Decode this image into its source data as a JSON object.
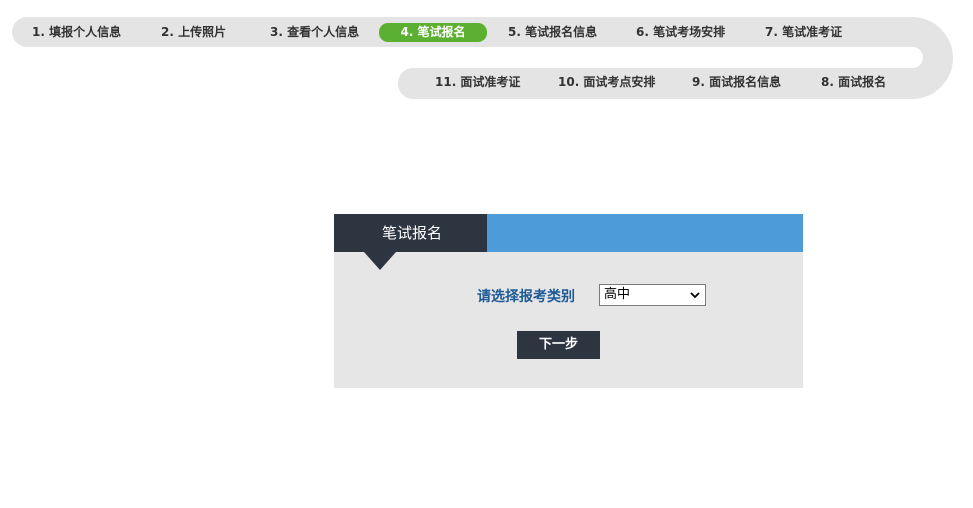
{
  "steps": {
    "top": [
      {
        "label": "1. 填报个人信息"
      },
      {
        "label": "2. 上传照片"
      },
      {
        "label": "3. 查看个人信息"
      },
      {
        "label": "4. 笔试报名"
      },
      {
        "label": "5. 笔试报名信息"
      },
      {
        "label": "6. 笔试考场安排"
      },
      {
        "label": "7. 笔试准考证"
      }
    ],
    "bottom": [
      {
        "label": "11. 面试准考证"
      },
      {
        "label": "10. 面试考点安排"
      },
      {
        "label": "9. 面试报名信息"
      },
      {
        "label": "8. 面试报名"
      }
    ],
    "active_color": "#5cb031"
  },
  "panel": {
    "title": "笔试报名",
    "form": {
      "label": "请选择报考类别",
      "selected": "高中"
    },
    "next_label": "下一步",
    "colors": {
      "header_dark": "#2d3541",
      "header_blue": "#4d9bd9",
      "label_blue": "#1d5a96"
    }
  }
}
